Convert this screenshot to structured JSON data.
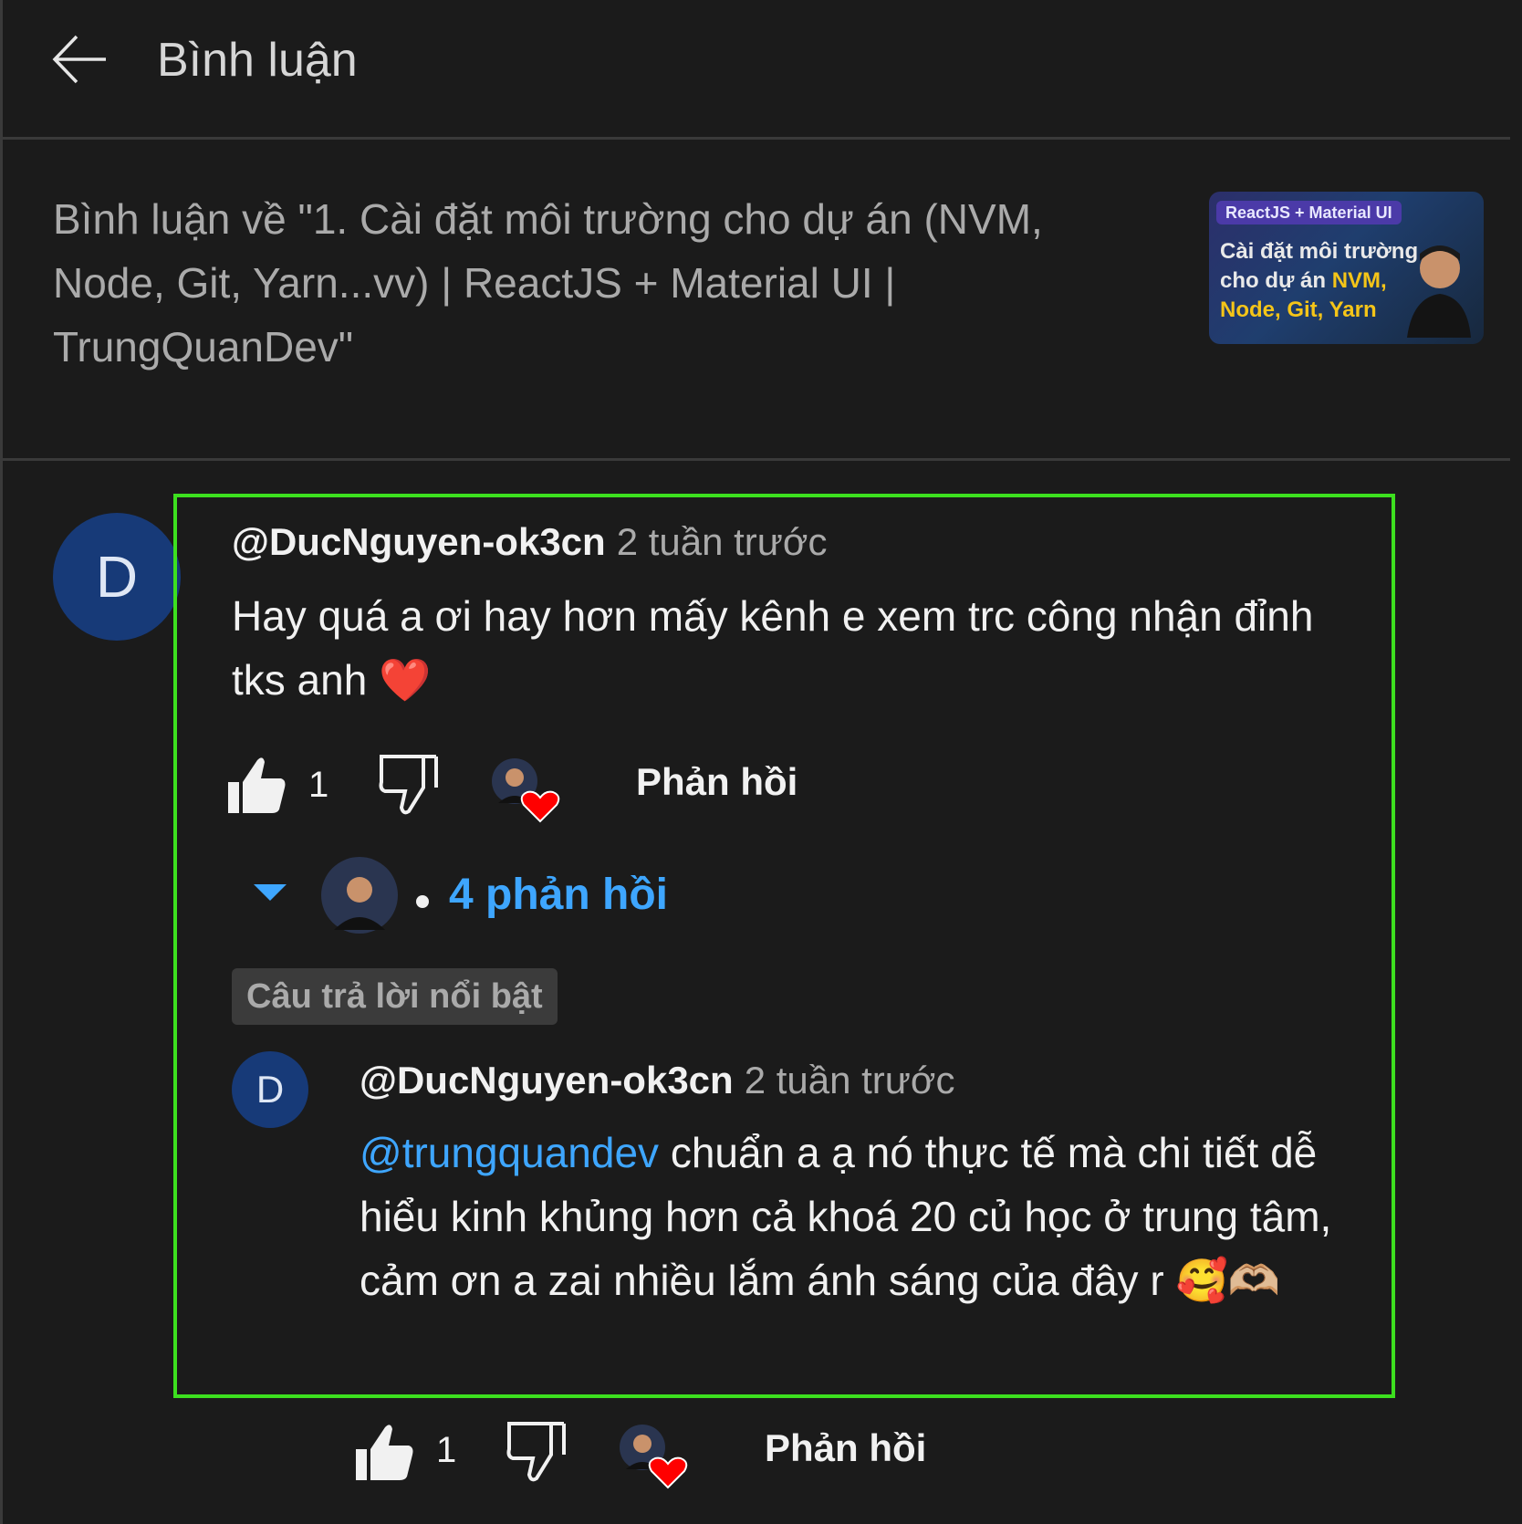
{
  "header": {
    "title": "Bình luận",
    "back_icon": "arrow-left-icon"
  },
  "video": {
    "title": "Bình luận về \"1. Cài đặt môi trường cho dự án (NVM, Node, Git, Yarn...vv) | ReactJS + Material UI | TrungQuanDev\"",
    "thumbnail": {
      "tag": "ReactJS + Material UI",
      "line1": "Cài đặt môi trường",
      "line2_prefix": "cho dự án ",
      "line2_highlight": "NVM,",
      "line3": "Node, Git, Yarn"
    }
  },
  "comment": {
    "avatar_letter": "D",
    "author": "@DucNguyen-ok3cn",
    "time": "2 tuần trước",
    "text": "Hay quá a ơi hay hơn mấy kênh e xem trc công nhận đỉnh tks anh ❤️",
    "likes": "1",
    "reply_label": "Phản hồi",
    "replies_toggle": "4 phản hồi",
    "highlight_badge": "Câu trả lời nổi bật"
  },
  "reply": {
    "avatar_letter": "D",
    "author": "@DucNguyen-ok3cn",
    "time": "2 tuần trước",
    "mention": "@trungquandev",
    "text": "chuẩn a ạ nó thực tế mà chi tiết dễ hiểu kinh khủng hơn cả khoá 20 củ học ở trung tâm, cảm ơn a zai nhiều lắm ánh sáng của đây r",
    "emojis": "🥰🫶🏼",
    "likes": "1",
    "reply_label": "Phản hồi"
  },
  "colors": {
    "accent": "#3ea6ff",
    "highlight_border": "#3de01f",
    "background": "#1b1b1b"
  }
}
